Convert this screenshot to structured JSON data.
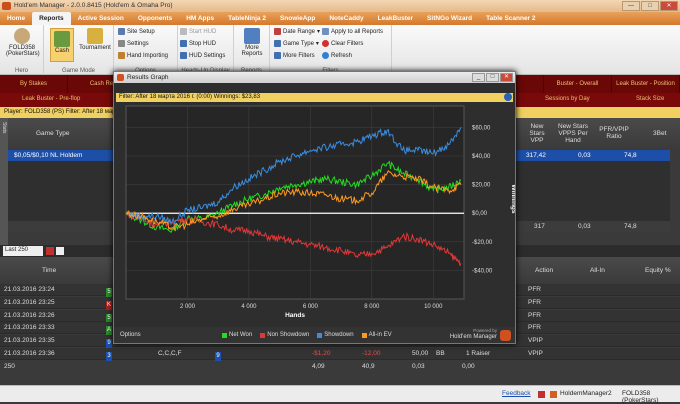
{
  "window": {
    "title": "Hold'em Manager - 2.0.0.8415 (Hold'em & Omaha Pro)",
    "min": "—",
    "max": "□",
    "close": "✕"
  },
  "menu": [
    "Home",
    "Reports",
    "Active Session",
    "Opponents",
    "HM Apps",
    "TableNinja 2",
    "SnowieApp",
    "NoteCaddy",
    "LeakBuster",
    "SitNGo Wizard",
    "Table Scanner 2"
  ],
  "ribbon": {
    "hero": {
      "name": "FOLD358",
      "site": "(PokerStars)",
      "group": "Hero"
    },
    "game_mode": {
      "cash": "Cash",
      "tournament": "Tournament",
      "group": "Game Mode"
    },
    "options": {
      "site_setup": "Site Setup",
      "settings": "Settings",
      "hand_importing": "Hand Importing",
      "group": "Options"
    },
    "hud": {
      "start": "Start HUD",
      "stop": "Stop HUD",
      "settings": "HUD Settings",
      "group": "Heads-Up Display"
    },
    "reports": {
      "more": "More",
      "reports": "Reports",
      "group": "Reports"
    },
    "filters": {
      "date_range": "Date Range",
      "game_type": "Game Type",
      "more_filters": "More Filters",
      "apply_all": "Apply to all Reports",
      "clear": "Clear Filters",
      "refresh": "Refresh",
      "group": "Filters"
    }
  },
  "tabs1": [
    "By Stakes",
    "Cash Re",
    "",
    "",
    "",
    "",
    "",
    "",
    "Buster - Overall",
    "Leak Buster - Position"
  ],
  "tabs2": {
    "left": "Leak Buster - Pre-flop",
    "right1": "Sessions by Day",
    "right2": "Stack Size"
  },
  "player_bar": "Player:  FOLD358 (PS)    Filter:  After 18 мapтa",
  "stats_label": "Stats",
  "grid": {
    "headers": {
      "game_type": "Game Type",
      "new_stars_vpp": "New Stars VPP",
      "new_stars_vpps": "New Stars VPPS Per Hand",
      "pfr_vpip": "PFR/VPIP Ratio",
      "three_bet": "3Bet"
    },
    "row": {
      "game": "$0,05/$0,10 NL Holdem",
      "vpp": "317,42",
      "vpps": "0,03",
      "ratio": "74,8"
    },
    "total": {
      "vpp": "317",
      "vpps": "0,03",
      "ratio": "74,8"
    }
  },
  "lower": {
    "last": "Last 250",
    "headers": {
      "time": "Time",
      "action": "Action",
      "allin": "All-In",
      "equity": "Equity %"
    },
    "rows": [
      {
        "time": "21.03.2016 23:24",
        "c1": "5",
        "c1c": "#2a8a2a",
        "c2": "",
        "action": "PFR"
      },
      {
        "time": "21.03.2016 23:25",
        "c1": "K",
        "c1c": "#b02020",
        "c2": "",
        "action": "PFR"
      },
      {
        "time": "21.03.2016 23:26",
        "c1": "5",
        "c1c": "#2a8a2a",
        "c2": "",
        "action": "PFR"
      },
      {
        "time": "21.03.2016 23:33",
        "c1": "A",
        "c1c": "#2a8a2a",
        "c2": "",
        "action": "PFR"
      },
      {
        "time": "21.03.2016 23:35",
        "c1": "9",
        "c1c": "#1a50b0",
        "c2": "",
        "action": "VPIP"
      },
      {
        "time": "21.03.2016 23:36",
        "c1": "A",
        "c1c": "#2a8a2a",
        "c2": "3",
        "actions": "C,C,C,F",
        "won": "-$1,20",
        "bb": "-12,00",
        "n": "50,00",
        "bbtxt": "BB",
        "pos": "1 Raiser",
        "action": "VPIP"
      }
    ],
    "board": [
      {
        "v": "6",
        "c": "#b02020"
      },
      {
        "v": "K",
        "c": "#b02020"
      },
      {
        "v": "2",
        "c": "#1a50b0"
      },
      {
        "v": "9",
        "c": "#1a50b0"
      }
    ],
    "footer": {
      "count": "250",
      "a": "4,09",
      "b": "40,9",
      "c": "0,03",
      "d": "0,00"
    }
  },
  "statusbar": {
    "feedback": "Feedback",
    "app": "HoldemManager2",
    "player": "FOLD358 (PokerStars)"
  },
  "graph": {
    "title": "Results Graph",
    "filter": "Filter: After 18 мapтa 2016 г. (0:00)   Winnings: $23,83",
    "options": "Options",
    "brand1": "Powered by",
    "brand2": "Hold'em Manager",
    "colors": {
      "net": "#22dd22",
      "nosd": "#e03838",
      "sd": "#3a8ee0",
      "ev": "#ff9a20"
    }
  },
  "chart_data": {
    "type": "line",
    "title": "",
    "xlabel": "Hands",
    "ylabel": "Winnings",
    "xlim": [
      0,
      11000
    ],
    "ylim": [
      -60,
      75
    ],
    "x_ticks": [
      "2 000",
      "4 000",
      "6 000",
      "8 000",
      "10 000"
    ],
    "x_tick_values": [
      2000,
      4000,
      6000,
      8000,
      10000
    ],
    "y_ticks": [
      "$60,00",
      "$40,00",
      "$20,00",
      "$0,00",
      "-$20,00",
      "-$40,00"
    ],
    "y_tick_values": [
      60,
      40,
      20,
      0,
      -20,
      -40
    ],
    "x": [
      0,
      500,
      1000,
      1500,
      2000,
      2500,
      3000,
      3500,
      4000,
      4500,
      5000,
      5500,
      6000,
      6500,
      7000,
      7500,
      8000,
      8500,
      9000,
      9500,
      10000,
      10500,
      10900
    ],
    "series": [
      {
        "name": "Net Won",
        "color": "#22dd22",
        "values": [
          0,
          -5,
          -10,
          -12,
          -3,
          -4,
          0,
          6,
          10,
          13,
          18,
          20,
          22,
          24,
          22,
          20,
          26,
          35,
          28,
          24,
          16,
          18,
          23
        ]
      },
      {
        "name": "Non Showdown",
        "color": "#e03838",
        "values": [
          0,
          -4,
          -8,
          -6,
          -4,
          -6,
          -8,
          -12,
          -12,
          -16,
          -18,
          -20,
          -22,
          -24,
          -26,
          -30,
          -28,
          -24,
          -16,
          -18,
          -22,
          -28,
          -35
        ]
      },
      {
        "name": "Showdown",
        "color": "#3a8ee0",
        "values": [
          0,
          -2,
          -2,
          -6,
          2,
          4,
          8,
          18,
          24,
          30,
          36,
          40,
          44,
          46,
          48,
          50,
          54,
          58,
          44,
          44,
          42,
          48,
          60
        ]
      },
      {
        "name": "All-in EV",
        "color": "#ff9a20",
        "values": [
          0,
          -2,
          -6,
          -10,
          -8,
          -4,
          -2,
          3,
          6,
          10,
          14,
          15,
          14,
          13,
          10,
          9,
          14,
          28,
          26,
          24,
          18,
          16,
          20
        ]
      }
    ],
    "legend": "bottom"
  }
}
